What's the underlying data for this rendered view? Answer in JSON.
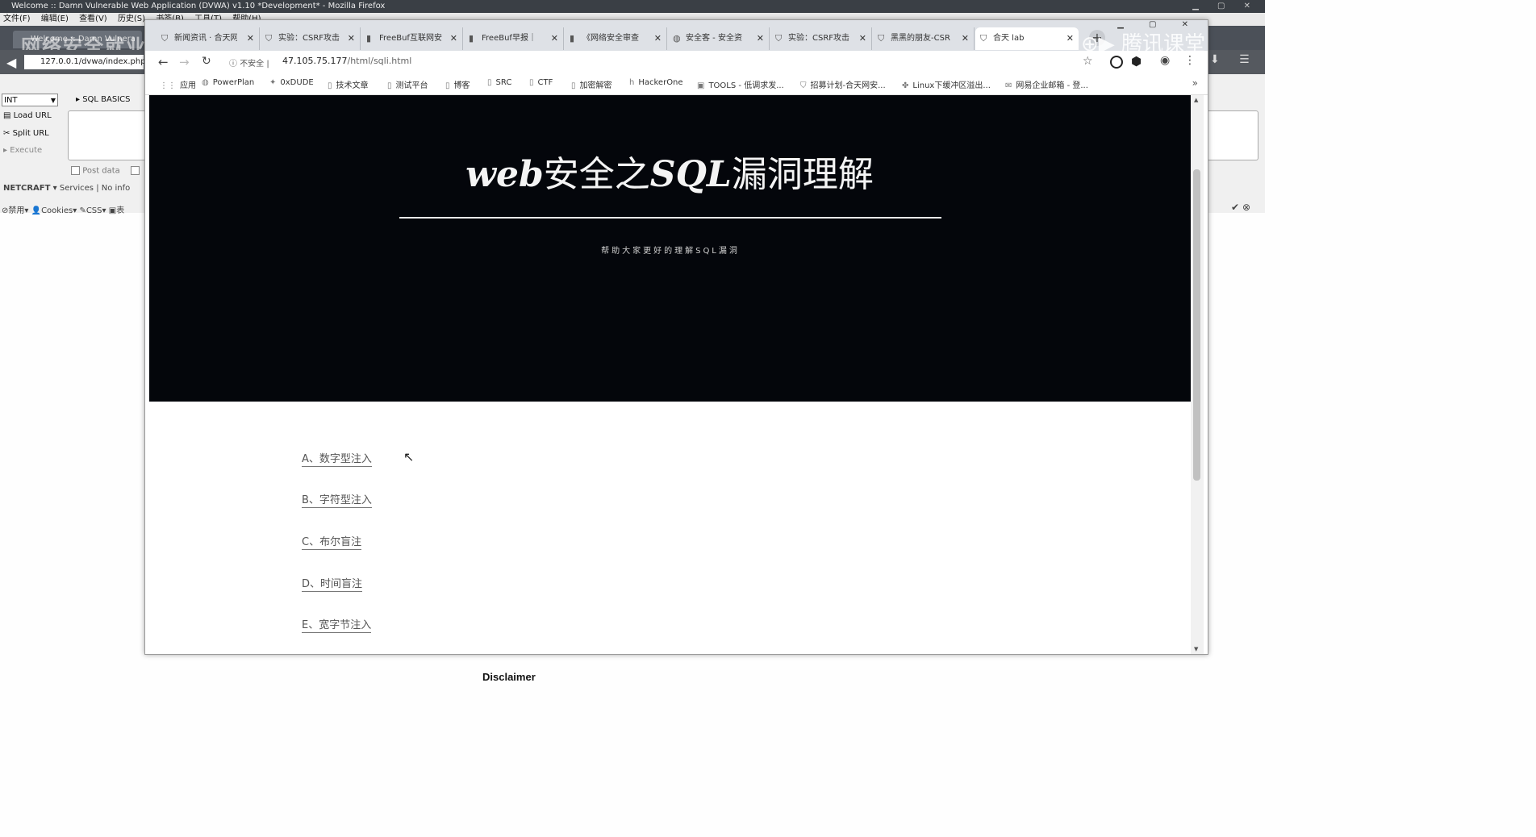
{
  "background_window": {
    "title": "Welcome :: Damn Vulnerable Web Application (DVWA) v1.10 *Development* - Mozilla Firefox",
    "menu": [
      "文件(F)",
      "编辑(E)",
      "查看(V)",
      "历史(S)",
      "书签(B)",
      "工具(T)",
      "帮助(H)"
    ],
    "tab_label": "Welcome :: Damn Vulnera",
    "watermark_left": "网络安全就业推荐学习",
    "watermark_right": "腾讯课堂",
    "url": "127.0.0.1/dvwa/index.php",
    "hackbar": {
      "select_value": "INT",
      "sql_basics": "SQL BASICS",
      "load_url": "Load URL",
      "split_url": "Split URL",
      "execute": "Execute",
      "post_data": "Post data",
      "netcraft": "NETCRAFT",
      "services": "Services",
      "no_info": "No info",
      "disable": "禁用",
      "cookies": "Cookies",
      "css": "CSS",
      "forms": "表"
    },
    "disclaimer": "Disclaimer"
  },
  "chrome": {
    "tabs": [
      {
        "label": "新闻资讯 · 合天网",
        "icon": "shield-icon"
      },
      {
        "label": "实验：CSRF攻击",
        "icon": "shield-icon"
      },
      {
        "label": "FreeBuf互联网安",
        "icon": "freebuf-icon"
      },
      {
        "label": "FreeBuf早报｜",
        "icon": "freebuf-icon"
      },
      {
        "label": "《网络安全审查",
        "icon": "freebuf-icon"
      },
      {
        "label": "安全客 - 安全资",
        "icon": "globe-icon"
      },
      {
        "label": "实验：CSRF攻击",
        "icon": "shield-icon"
      },
      {
        "label": "黑黑的朋友-CSR",
        "icon": "shield-icon"
      },
      {
        "label": "合天 lab",
        "icon": "shield-icon",
        "active": true
      }
    ],
    "security_label": "不安全",
    "url_host": "47.105.75.177",
    "url_path": "/html/sqli.html",
    "bookmarks": [
      {
        "label": "应用",
        "icon": "apps-icon"
      },
      {
        "label": "PowerPlan",
        "icon": "globe-icon"
      },
      {
        "label": "0xDUDE",
        "icon": "twitter-icon"
      },
      {
        "label": "技术文章",
        "icon": "folder-icon"
      },
      {
        "label": "测试平台",
        "icon": "folder-icon"
      },
      {
        "label": "博客",
        "icon": "folder-icon"
      },
      {
        "label": "SRC",
        "icon": "folder-icon"
      },
      {
        "label": "CTF",
        "icon": "folder-icon"
      },
      {
        "label": "加密解密",
        "icon": "folder-icon"
      },
      {
        "label": "HackerOne",
        "icon": "hackerone-icon"
      },
      {
        "label": "TOOLS - 低调求发...",
        "icon": "tools-icon"
      },
      {
        "label": "招募计划-合天网安...",
        "icon": "shield-icon"
      },
      {
        "label": "Linux下缓冲区溢出...",
        "icon": "linux-icon"
      },
      {
        "label": "网易企业邮箱 - 登...",
        "icon": "mail-icon"
      }
    ]
  },
  "page": {
    "hero_title_latin": "web",
    "hero_title_cn1": "安全之",
    "hero_title_latin2": "SQL",
    "hero_title_cn2": "漏洞理解",
    "hero_subtitle": "帮助大家更好的理解SQL漏洞",
    "toc": [
      "A、数字型注入",
      "B、字符型注入",
      "C、布尔盲注",
      "D、时间盲注",
      "E、宽字节注入"
    ]
  },
  "colors": {
    "hero_bg": "#04060b",
    "tabstrip_bg": "#dee1e6",
    "link": "#555555"
  }
}
